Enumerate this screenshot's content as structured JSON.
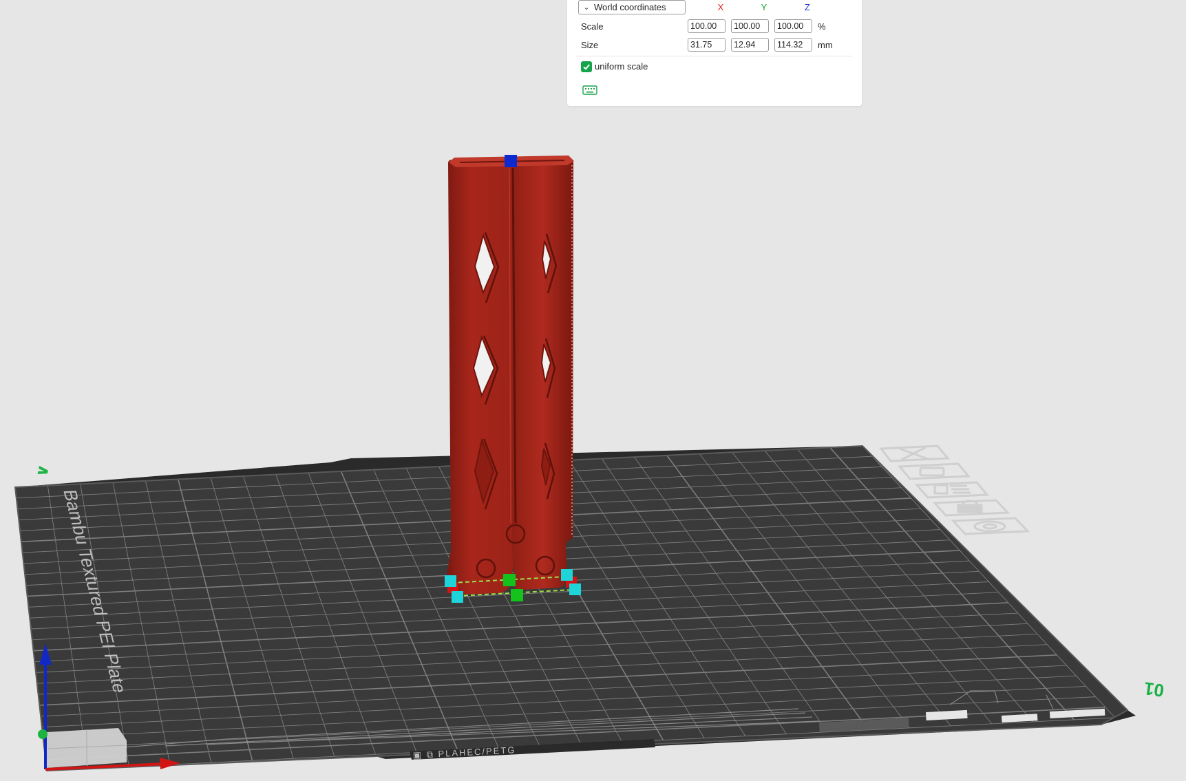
{
  "scale_panel": {
    "coordinate_system": "World coordinates",
    "axes": {
      "x": "X",
      "y": "Y",
      "z": "Z"
    },
    "axis_colors": {
      "x": "#e01e1e",
      "y": "#17a32f",
      "z": "#2233dd"
    },
    "scale": {
      "label": "Scale",
      "x": "100.00",
      "y": "100.00",
      "z": "100.00",
      "unit": "%"
    },
    "size": {
      "label": "Size",
      "x": "31.75",
      "y": "12.94",
      "z": "114.32",
      "unit": "mm"
    },
    "uniform_scale": {
      "label": "uniform scale",
      "checked": true
    },
    "keyboard_icon": "keyboard-icon"
  },
  "scene": {
    "plate_name": "Bambu Textured PEI Plate",
    "plate_number": "01",
    "plate_corner_mark": "∨",
    "model_color": "#a8261b",
    "plate_icons": [
      "close-icon",
      "copy-icon",
      "arrange-icon",
      "lock-icon",
      "settings-icon"
    ]
  }
}
